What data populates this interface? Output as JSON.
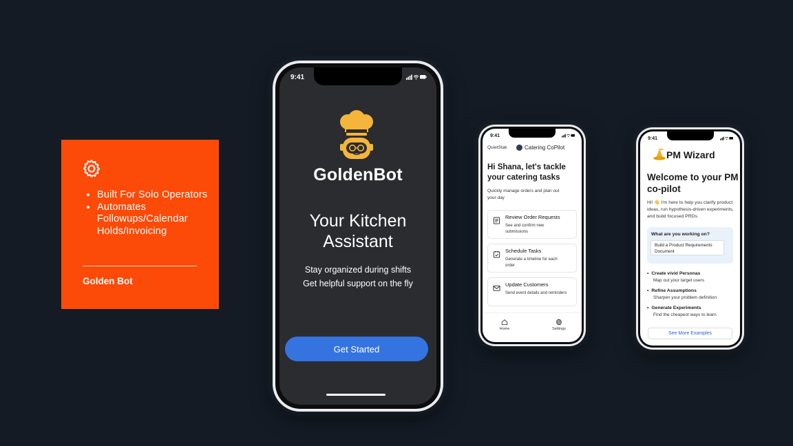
{
  "colors": {
    "background": "#141b25",
    "accent_orange": "#fc4a08",
    "cta_blue": "#3574e0",
    "logo_gold": "#f5b53a"
  },
  "card": {
    "icon": "gear-icon",
    "bullets": [
      "Built For Solo Operators",
      "Automates Followups/Calendar Holds/Invoicing"
    ],
    "title": "Golden Bot"
  },
  "goldenbot": {
    "status_time": "9:41",
    "logo_icon": "chef-robot-icon",
    "brand": "GoldenBot",
    "headline_line1": "Your Kitchen",
    "headline_line2": "Assistant",
    "sub_line1": "Stay organized during shifts",
    "sub_line2": "Get helpful support on the fly",
    "cta": "Get Started"
  },
  "catering": {
    "status_time": "9:41",
    "company": "QuietStak",
    "app_name": "Catering CoPilot",
    "greeting": "Hi Shana, let's tackle your catering tasks",
    "subtitle": "Quickly manage orders and plan out your day",
    "tasks": [
      {
        "icon": "document-icon",
        "title": "Review Order Requests",
        "desc": "See and confirm new submissions"
      },
      {
        "icon": "calendar-check-icon",
        "title": "Schedule Tasks",
        "desc": "Generate a timeline for each order"
      },
      {
        "icon": "mail-icon",
        "title": "Update Customers",
        "desc": "Send event details and reminders"
      }
    ],
    "tabs": [
      {
        "icon": "home-icon",
        "label": "Home"
      },
      {
        "icon": "gear-icon",
        "label": "Settings"
      }
    ]
  },
  "pmwizard": {
    "status_time": "9:41",
    "logo_icon": "wizard-hat-icon",
    "app_name": "PM Wizard",
    "welcome": "Welcome to your PM co-pilot",
    "intro": "Hi! 👋 I'm here to help you clarify product ideas, run hypothesis-driven experiments, and build focused PRDs.",
    "question": "What are you working on?",
    "answer": "Build a Product Requirements Document",
    "features": [
      {
        "title": "Create vivid Personas",
        "desc": "Map out your target users"
      },
      {
        "title": "Refine Assumptions",
        "desc": "Sharpen your problem definition"
      },
      {
        "title": "Generate Experiments",
        "desc": "Find the cheapest ways to learn"
      }
    ],
    "more_button": "See More Examples"
  }
}
